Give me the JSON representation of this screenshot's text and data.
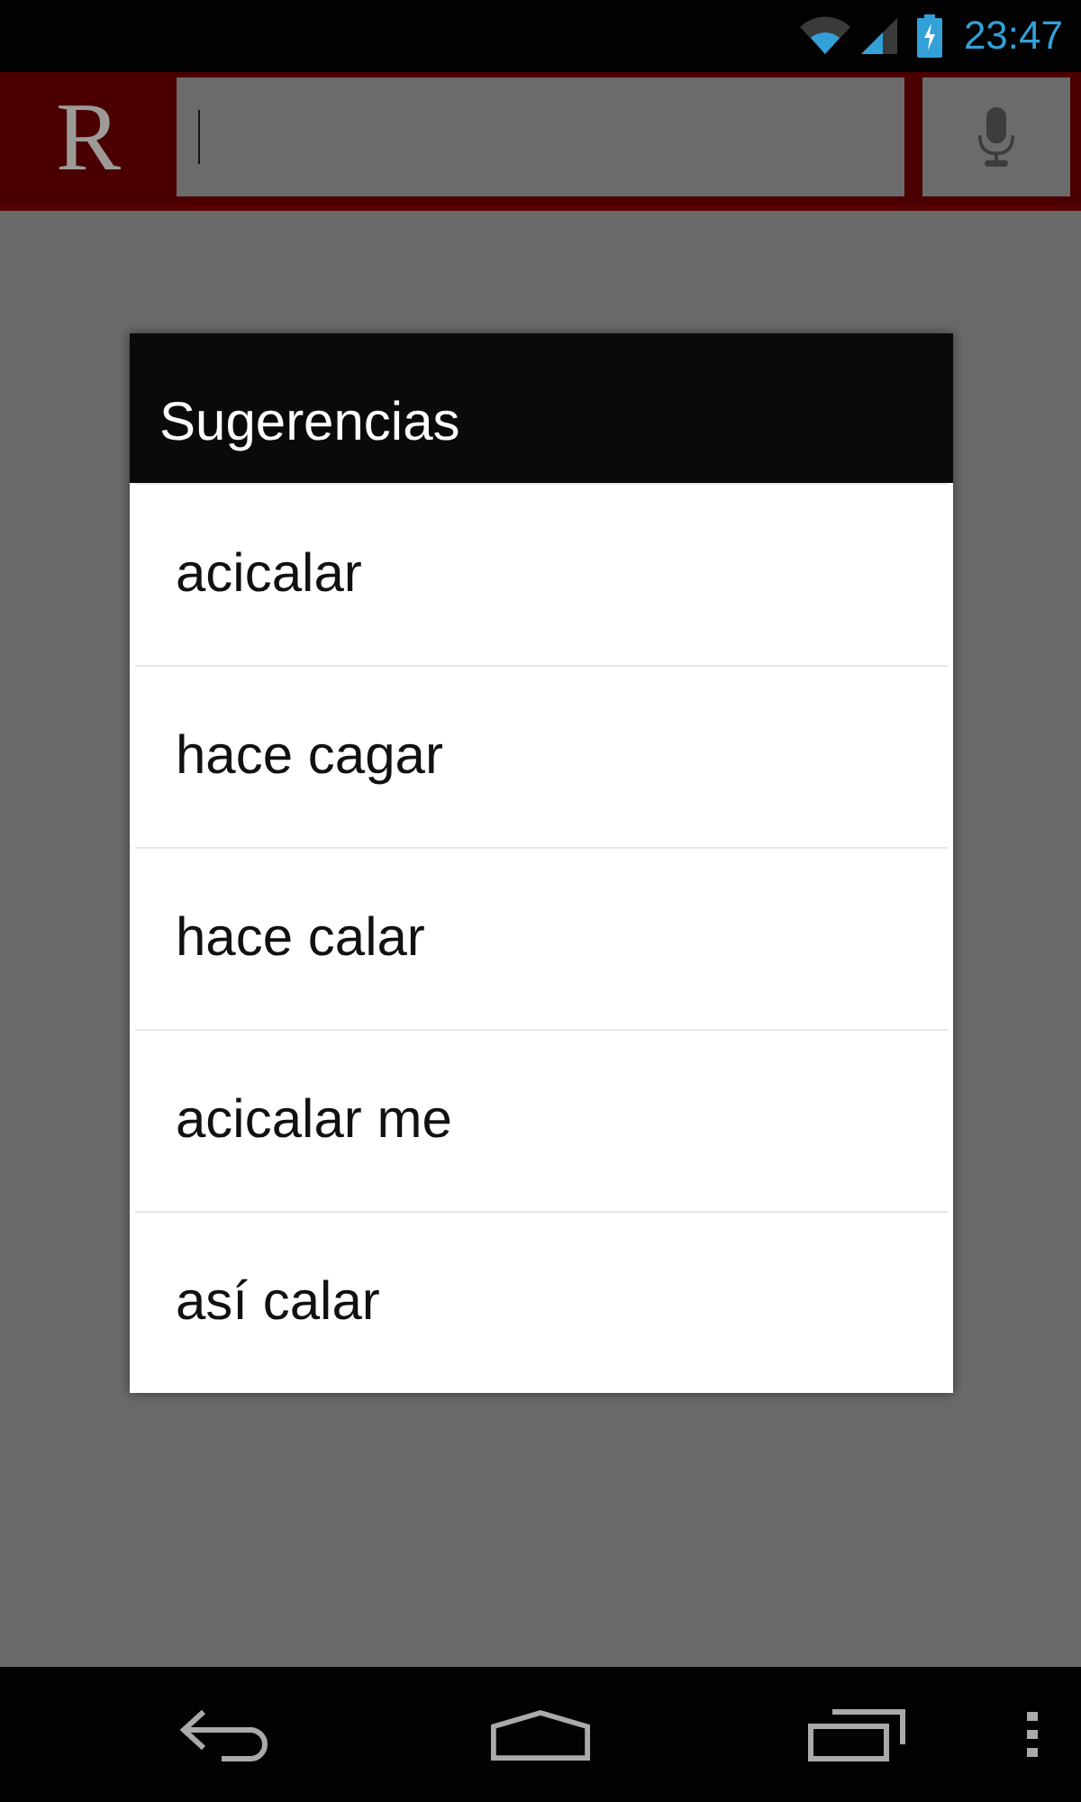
{
  "status_bar": {
    "time": "23:47"
  },
  "app_bar": {
    "logo": "R"
  },
  "dialog": {
    "title": "Sugerencias",
    "items": [
      {
        "label": "acicalar"
      },
      {
        "label": "hace cagar"
      },
      {
        "label": "hace calar"
      },
      {
        "label": "acicalar me"
      },
      {
        "label": "así calar"
      }
    ]
  }
}
